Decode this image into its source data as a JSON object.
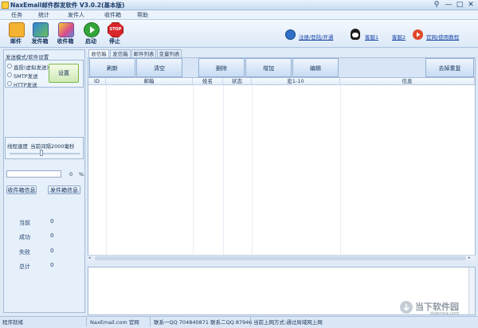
{
  "window": {
    "title": "NaxEmail邮件群发软件 V3.0.2(基本版)",
    "min": "—",
    "max": "□",
    "close": "✕",
    "pin": "⚲"
  },
  "menu": [
    "任务",
    "统计",
    "发件人",
    "收件箱",
    "帮助"
  ],
  "toolbar": {
    "buttons": [
      {
        "label": "邮件",
        "icon": "envelope-icon"
      },
      {
        "label": "发件箱",
        "icon": "outbox-icon"
      },
      {
        "label": "收件箱",
        "icon": "inbox-icon"
      },
      {
        "label": "启动",
        "icon": "play-icon"
      },
      {
        "label": "停止",
        "icon": "stop-icon"
      }
    ],
    "links": {
      "register": "注册/登陆/开通",
      "qq1": "客服1",
      "qq2": "客服2",
      "help": "官网/使用教程"
    }
  },
  "left": {
    "send_mode_title": "发送模式/软件设置",
    "modes": [
      "直投(虚拟发送)",
      "SMTP发送",
      "HTTP发送"
    ],
    "settings_button": "设置",
    "speed_title": "线程速度",
    "speed_value": "当前间隔2000毫秒",
    "progress_value": "0",
    "progress_unit": "%",
    "recv_info_button": "收件箱信息",
    "send_info_button": "发件箱信息",
    "stats": [
      {
        "label": "当前",
        "value": "0"
      },
      {
        "label": "成功",
        "value": "0"
      },
      {
        "label": "失败",
        "value": "0"
      },
      {
        "label": "总计",
        "value": "0"
      }
    ]
  },
  "tabs": [
    "收信箱",
    "发信箱",
    "邮件列表",
    "变量列表"
  ],
  "actions": {
    "refresh": "刷新",
    "clear": "清空",
    "delete": "删除",
    "add": "增加",
    "edit": "编辑",
    "dedupe": "去掉重复"
  },
  "grid": {
    "columns": [
      "ID",
      "邮箱",
      "姓名",
      "状态",
      "宏1-10",
      "信息"
    ]
  },
  "status": {
    "ready": "程序就绪",
    "site": "NaxEmail.com 官网",
    "contact": "联系一QQ 704840871 联系二QQ 87946",
    "note": "当前上网方式:通过局域网上网"
  },
  "watermark": {
    "text": "当下软件园",
    "url": "downxia.com"
  }
}
